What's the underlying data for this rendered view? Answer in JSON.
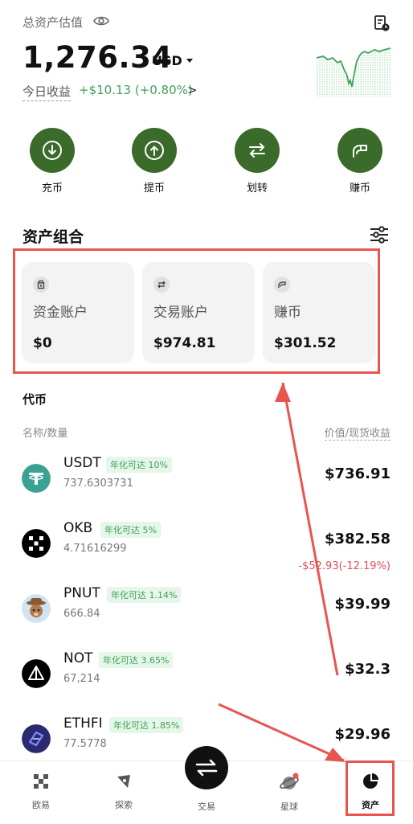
{
  "header": {
    "total_label": "总资产估值",
    "balance": "1,276.34",
    "currency": "USD",
    "today_label": "今日收益",
    "today_value": "+$10.13 (+0.80%)",
    "today_arrow": ">"
  },
  "actions": [
    {
      "label": "充币",
      "icon": "deposit-icon"
    },
    {
      "label": "提币",
      "icon": "withdraw-icon"
    },
    {
      "label": "划转",
      "icon": "transfer-icon"
    },
    {
      "label": "赚币",
      "icon": "earn-icon"
    }
  ],
  "portfolio": {
    "title": "资产组合",
    "cards": [
      {
        "name": "资金账户",
        "value": "$0",
        "icon": "wallet-icon"
      },
      {
        "name": "交易账户",
        "value": "$974.81",
        "icon": "swap-icon"
      },
      {
        "name": "赚币",
        "value": "$301.52",
        "icon": "earn-icon"
      }
    ]
  },
  "tokens": {
    "title": "代币",
    "col_left": "名称/数量",
    "col_right": "价值/现货收益",
    "items": [
      {
        "symbol": "USDT",
        "apr": "年化可达 10%",
        "qty": "737.6303731",
        "value": "$736.91",
        "change": ""
      },
      {
        "symbol": "OKB",
        "apr": "年化可达 5%",
        "qty": "4.71616299",
        "value": "$382.58",
        "change": "-$52.93(-12.19%)"
      },
      {
        "symbol": "PNUT",
        "apr": "年化可达 1.14%",
        "qty": "666.84",
        "value": "$39.99",
        "change": ""
      },
      {
        "symbol": "NOT",
        "apr": "年化可达 3.65%",
        "qty": "67,214",
        "value": "$32.3",
        "change": ""
      },
      {
        "symbol": "ETHFI",
        "apr": "年化可达 1.85%",
        "qty": "77.5778",
        "value": "$29.96",
        "change": ""
      }
    ]
  },
  "tabbar": {
    "tabs": [
      {
        "label": "欧易",
        "icon": "okx-logo-icon"
      },
      {
        "label": "探索",
        "icon": "compass-icon"
      },
      {
        "label": "交易",
        "icon": "trade-swap-icon"
      },
      {
        "label": "星球",
        "icon": "planet-icon"
      },
      {
        "label": "资产",
        "icon": "pie-chart-icon"
      }
    ]
  },
  "colors": {
    "accent_green": "#3a6b2a",
    "positive": "#3fa05a",
    "negative": "#d9505a",
    "annotation_red": "#e8544f"
  }
}
